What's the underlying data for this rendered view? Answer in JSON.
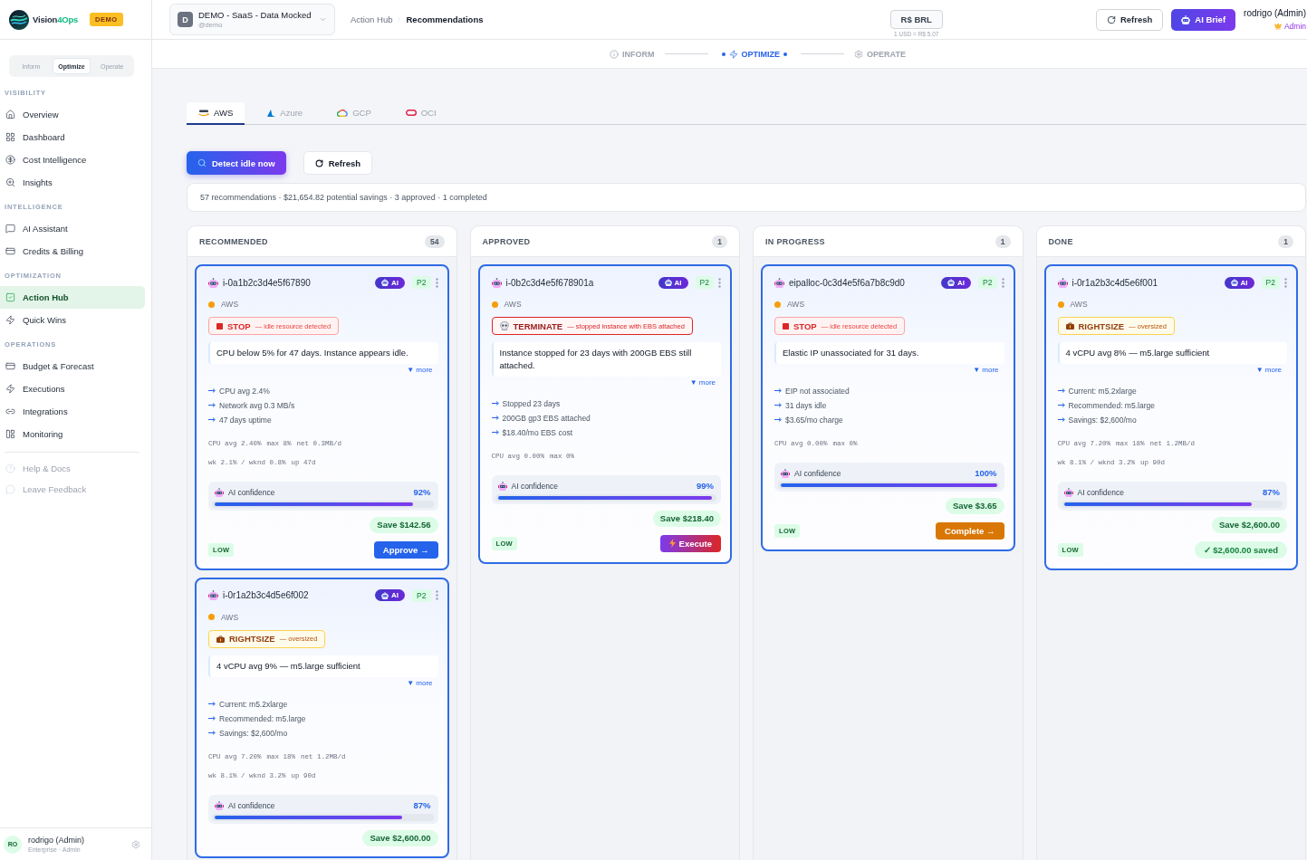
{
  "brand": {
    "name": "Vision",
    "accent": "4Ops",
    "badge": "DEMO"
  },
  "workspace": {
    "initial": "D",
    "name": "DEMO - SaaS - Data Mocked",
    "handle": "@demo"
  },
  "breadcrumb": {
    "parent": "Action Hub",
    "current": "Recommendations"
  },
  "currency": {
    "label": "R$ BRL",
    "rate": "1 USD = R$ 5.07"
  },
  "header_buttons": [
    {
      "kind": "refresh",
      "label": "Refresh"
    },
    {
      "kind": "ai_brief",
      "label": "AI Brief"
    }
  ],
  "user": {
    "name": "rodrigo (Admin)",
    "role": "Admin"
  },
  "stepper": [
    {
      "label": "INFORM",
      "selected": false
    },
    {
      "label": "OPTIMIZE",
      "selected": true
    },
    {
      "label": "OPERATE",
      "selected": false
    }
  ],
  "sidebar": {
    "modes": [
      {
        "label": "Inform",
        "selected": false
      },
      {
        "label": "Optimize",
        "selected": true
      },
      {
        "label": "Operate",
        "selected": false
      }
    ],
    "sections": [
      {
        "title": "VISIBILITY",
        "items": [
          {
            "label": "Overview",
            "selected": false
          },
          {
            "label": "Dashboard",
            "selected": false
          },
          {
            "label": "Cost Intelligence",
            "selected": false
          },
          {
            "label": "Insights",
            "selected": false
          }
        ]
      },
      {
        "title": "INTELLIGENCE",
        "items": [
          {
            "label": "AI Assistant",
            "selected": false
          },
          {
            "label": "Credits & Billing",
            "selected": false
          }
        ]
      },
      {
        "title": "OPTIMIZATION",
        "items": [
          {
            "label": "Action Hub",
            "selected": true
          },
          {
            "label": "Quick Wins",
            "selected": false
          }
        ]
      },
      {
        "title": "OPERATIONS",
        "items": [
          {
            "label": "Budget & Forecast",
            "selected": false
          },
          {
            "label": "Executions",
            "selected": false
          },
          {
            "label": "Integrations",
            "selected": false
          },
          {
            "label": "Monitoring",
            "selected": false
          }
        ]
      }
    ],
    "support_links": [
      "Help & Docs",
      "Leave Feedback"
    ],
    "footer": {
      "initials": "RO",
      "name": "rodrigo (Admin)",
      "plan": "Enterprise · Admin"
    }
  },
  "providers": [
    {
      "label": "AWS",
      "selected": true
    },
    {
      "label": "Azure",
      "selected": false
    },
    {
      "label": "GCP",
      "selected": false
    },
    {
      "label": "OCI",
      "selected": false
    }
  ],
  "actions": [
    {
      "kind": "detect",
      "label": "Detect idle now"
    },
    {
      "kind": "refresh",
      "label": "Refresh"
    }
  ],
  "summary": "57 recommendations · $21,654.82 potential savings · 3 approved · 1 completed",
  "columns": [
    {
      "title": "RECOMMENDED",
      "count": "54",
      "cards": [
        {
          "id": "i-0a1b2c3d4e5f67890",
          "ai_label": "AI",
          "priority": "P2",
          "provider": "AWS",
          "action": {
            "kind": "stop",
            "label": "STOP",
            "reason": "— idle resource detected"
          },
          "description": "CPU below 5% for 47 days. Instance appears idle.",
          "more": "▼ more",
          "details": [
            "CPU avg 2.4%",
            "Network avg 0.3 MB/s",
            "47 days uptime"
          ],
          "metrics": [
            [
              "CPU avg 2.40%",
              "max 8%",
              "net 0.3MB/d"
            ],
            [
              "wk 2.1% / wknd 0.8%",
              "up 47d"
            ]
          ],
          "confidence": {
            "label": "AI confidence",
            "value": "92%",
            "level": 0.92
          },
          "savings": "Save $142.56",
          "risk": "LOW",
          "button": {
            "kind": "approve",
            "label": "Approve →"
          }
        },
        {
          "id": "i-0r1a2b3c4d5e6f002",
          "ai_label": "AI",
          "priority": "P2",
          "provider": "AWS",
          "action": {
            "kind": "rightsize",
            "label": "RIGHTSIZE",
            "reason": "— oversized"
          },
          "description": "4 vCPU avg 9% — m5.large sufficient",
          "more": "▼ more",
          "details": [
            "Current: m5.2xlarge",
            "Recommended: m5.large",
            "Savings: $2,600/mo"
          ],
          "metrics": [
            [
              "CPU avg 7.20%",
              "max 18%",
              "net 1.2MB/d"
            ],
            [
              "wk 8.1% / wknd 3.2%",
              "up 90d"
            ]
          ],
          "confidence": {
            "label": "AI confidence",
            "value": "87%",
            "level": 0.87
          },
          "savings": "Save $2,600.00"
        }
      ]
    },
    {
      "title": "APPROVED",
      "count": "1",
      "cards": [
        {
          "id": "i-0b2c3d4e5f678901a",
          "ai_label": "AI",
          "priority": "P2",
          "provider": "AWS",
          "action": {
            "kind": "terminate",
            "label": "TERMINATE",
            "reason": "— stopped instance with EBS attached"
          },
          "description": "Instance stopped for 23 days with 200GB EBS still attached.",
          "more": "▼ more",
          "details": [
            "Stopped 23 days",
            "200GB gp3 EBS attached",
            "$18.40/mo EBS cost"
          ],
          "metrics": [
            [
              "CPU avg 0.00%",
              "max 0%"
            ]
          ],
          "confidence": {
            "label": "AI confidence",
            "value": "99%",
            "level": 0.99
          },
          "savings": "Save $218.40",
          "risk": "LOW",
          "button": {
            "kind": "execute",
            "label": "Execute"
          }
        }
      ]
    },
    {
      "title": "IN PROGRESS",
      "count": "1",
      "cards": [
        {
          "id": "eipalloc-0c3d4e5f6a7b8c9d0",
          "ai_label": "AI",
          "priority": "P2",
          "provider": "AWS",
          "action": {
            "kind": "stop",
            "label": "STOP",
            "reason": "— idle resource detected"
          },
          "description": "Elastic IP unassociated for 31 days.",
          "more": "▼ more",
          "details": [
            "EIP not associated",
            "31 days idle",
            "$3.65/mo charge"
          ],
          "metrics": [
            [
              "CPU avg 0.00%",
              "max 0%"
            ]
          ],
          "confidence": {
            "label": "AI confidence",
            "value": "100%",
            "level": 1
          },
          "savings": "Save $3.65",
          "risk": "LOW",
          "button": {
            "kind": "complete",
            "label": "Complete →"
          }
        }
      ]
    },
    {
      "title": "DONE",
      "count": "1",
      "cards": [
        {
          "id": "i-0r1a2b3c4d5e6f001",
          "ai_label": "AI",
          "priority": "P2",
          "provider": "AWS",
          "action": {
            "kind": "rightsize",
            "label": "RIGHTSIZE",
            "reason": "— oversized"
          },
          "description": "4 vCPU avg 8% — m5.large sufficient",
          "more": "▼ more",
          "details": [
            "Current: m5.2xlarge",
            "Recommended: m5.large",
            "Savings: $2,600/mo"
          ],
          "metrics": [
            [
              "CPU avg 7.20%",
              "max 18%",
              "net 1.2MB/d"
            ],
            [
              "wk 8.1% / wknd 3.2%",
              "up 90d"
            ]
          ],
          "confidence": {
            "label": "AI confidence",
            "value": "87%",
            "level": 0.87
          },
          "savings": "Save $2,600.00",
          "risk": "LOW",
          "button": {
            "kind": "saved",
            "label": "✓ $2,600.00 saved"
          }
        }
      ]
    }
  ]
}
